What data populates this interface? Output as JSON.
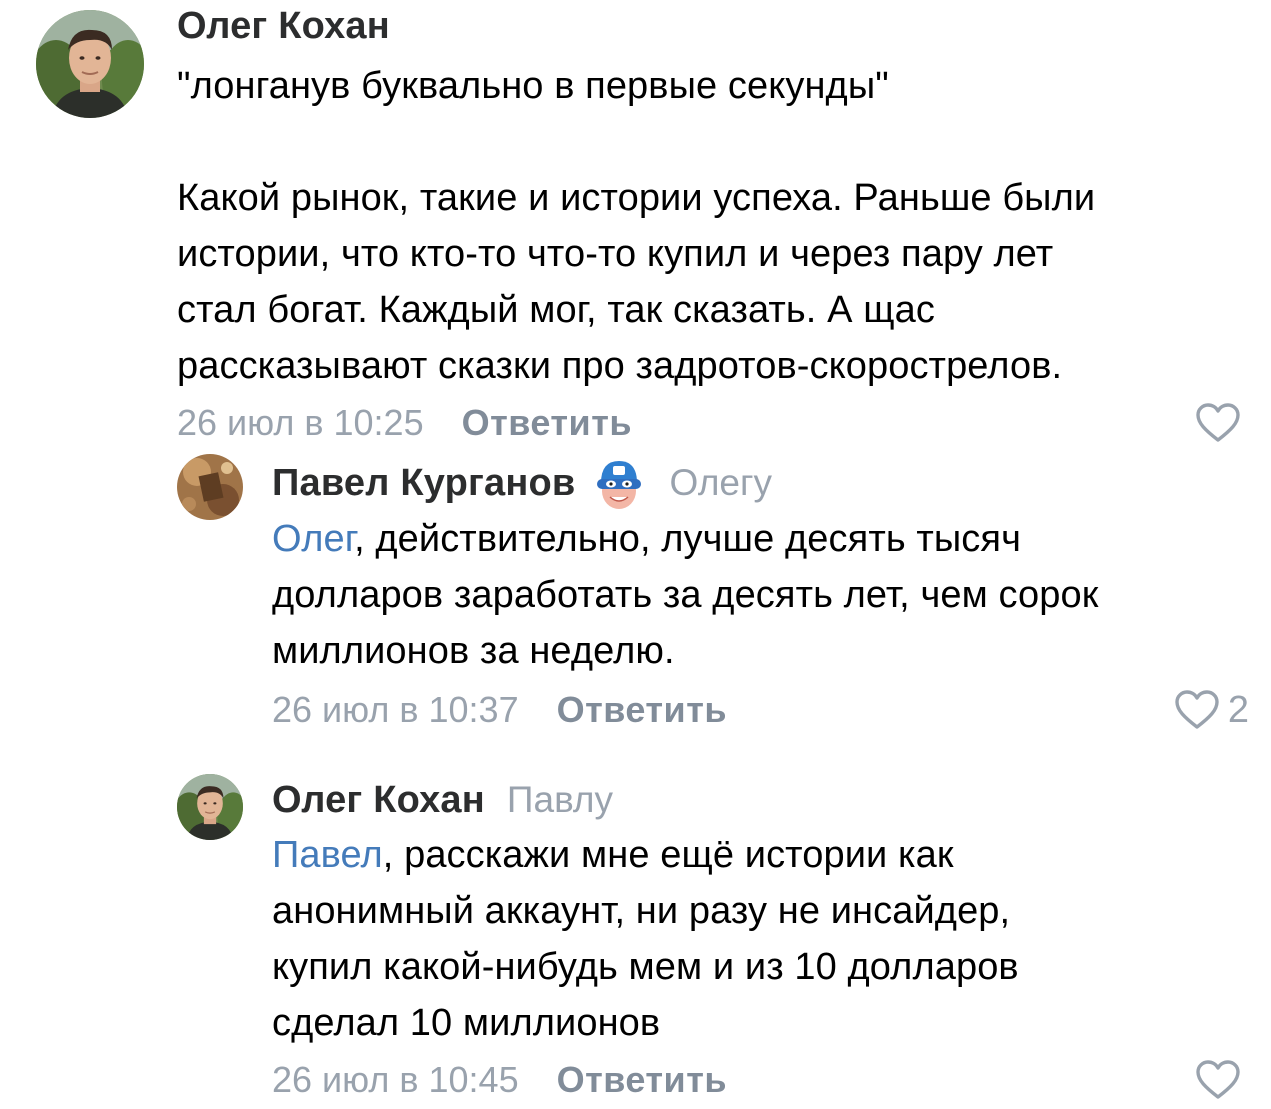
{
  "comments": [
    {
      "author": "Олег Кохан",
      "reply_to": "",
      "mention": "",
      "text_lines": [
        "\"лонганув буквально в первые секунды\"",
        "",
        "Какой рынок, такие и истории успеха. Раньше были",
        "истории, что кто-то что-то купил и через пару лет",
        "стал богат. Каждый мог, так сказать. А щас",
        "рассказывают сказки про задротов-скорострелов."
      ],
      "date": "26 июл в 10:25",
      "reply_label": "Ответить",
      "like_count": ""
    },
    {
      "author": "Павел Курганов",
      "reply_to": "Олегу",
      "mention": "Олег",
      "text_first": ", действительно, лучше десять тысяч",
      "text_lines": [
        "долларов заработать за десять лет, чем сорок",
        "миллионов за неделю."
      ],
      "date": "26 июл в 10:37",
      "reply_label": "Ответить",
      "like_count": "2"
    },
    {
      "author": "Олег Кохан",
      "reply_to": "Павлу",
      "mention": "Павел",
      "text_first": ", расскажи мне ещё истории как",
      "text_lines": [
        "анонимный аккаунт, ни разу не инсайдер,",
        "купил какой-нибудь мем и из 10 долларов",
        "сделал 10 миллионов"
      ],
      "date": "26 июл в 10:45",
      "reply_label": "Ответить",
      "like_count": ""
    }
  ],
  "colors": {
    "mention": "#447bba",
    "meta": "#99a2ad",
    "reply_button": "#818c99",
    "author": "#2c2d2e"
  },
  "icons": {
    "like": "heart-outline-icon",
    "badge": "masked-hero-badge-icon"
  }
}
